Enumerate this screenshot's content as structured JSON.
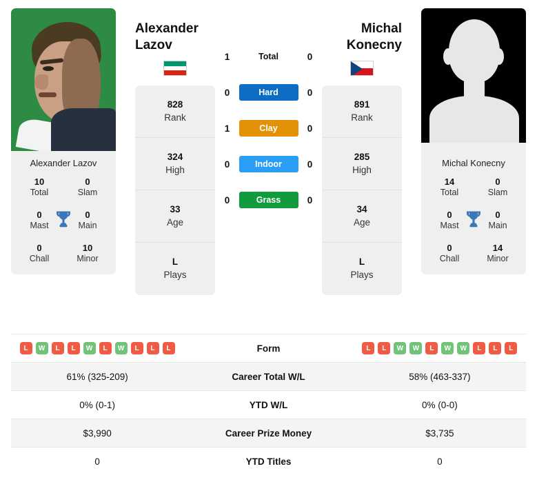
{
  "players": {
    "left": {
      "name": "Alexander Lazov",
      "name_line1": "Alexander",
      "name_line2": "Lazov",
      "flag": "bulgaria-flag",
      "photo": "player-photo",
      "stats": [
        {
          "value": "828",
          "key": "Rank"
        },
        {
          "value": "324",
          "key": "High"
        },
        {
          "value": "33",
          "key": "Age"
        },
        {
          "value": "L",
          "key": "Plays"
        }
      ],
      "titles": [
        {
          "value": "10",
          "key": "Total"
        },
        {
          "value": "0",
          "key": "Slam"
        },
        {
          "value": "0",
          "key": "Mast"
        },
        {
          "value": "0",
          "key": "Main"
        },
        {
          "value": "0",
          "key": "Chall"
        },
        {
          "value": "10",
          "key": "Minor"
        }
      ],
      "form": [
        "L",
        "W",
        "L",
        "L",
        "W",
        "L",
        "W",
        "L",
        "L",
        "L"
      ],
      "career_total_wl": "61% (325-209)",
      "ytd_wl": "0% (0-1)",
      "career_prize_money": "$3,990",
      "ytd_titles": "0"
    },
    "right": {
      "name": "Michal Konecny",
      "name_line1": "Michal",
      "name_line2": "Konecny",
      "flag": "czech-republic-flag",
      "photo": "player-photo-placeholder",
      "stats": [
        {
          "value": "891",
          "key": "Rank"
        },
        {
          "value": "285",
          "key": "High"
        },
        {
          "value": "34",
          "key": "Age"
        },
        {
          "value": "L",
          "key": "Plays"
        }
      ],
      "titles": [
        {
          "value": "14",
          "key": "Total"
        },
        {
          "value": "0",
          "key": "Slam"
        },
        {
          "value": "0",
          "key": "Mast"
        },
        {
          "value": "0",
          "key": "Main"
        },
        {
          "value": "0",
          "key": "Chall"
        },
        {
          "value": "14",
          "key": "Minor"
        }
      ],
      "form": [
        "L",
        "L",
        "W",
        "W",
        "L",
        "W",
        "W",
        "L",
        "L",
        "L"
      ],
      "career_total_wl": "58% (463-337)",
      "ytd_wl": "0% (0-0)",
      "career_prize_money": "$3,735",
      "ytd_titles": "0"
    }
  },
  "head_to_head": [
    {
      "label": "Total",
      "left": "1",
      "right": "0",
      "color": "",
      "plain": true
    },
    {
      "label": "Hard",
      "left": "0",
      "right": "0",
      "color": "#0b6ec4"
    },
    {
      "label": "Clay",
      "left": "1",
      "right": "0",
      "color": "#e39106"
    },
    {
      "label": "Indoor",
      "left": "0",
      "right": "0",
      "color": "#2a9df4"
    },
    {
      "label": "Grass",
      "left": "0",
      "right": "0",
      "color": "#119b3c"
    }
  ],
  "table_rows": [
    {
      "label": "Form",
      "type": "form"
    },
    {
      "label": "Career Total W/L",
      "type": "text",
      "left": "61% (325-209)",
      "right": "58% (463-337)"
    },
    {
      "label": "YTD W/L",
      "type": "text",
      "left": "0% (0-1)",
      "right": "0% (0-0)"
    },
    {
      "label": "Career Prize Money",
      "type": "text",
      "left": "$3,990",
      "right": "$3,735"
    },
    {
      "label": "YTD Titles",
      "type": "text",
      "left": "0",
      "right": "0"
    }
  ],
  "colors": {
    "win": "#72c278",
    "loss": "#ef5b45",
    "trophy": "#3b76b8",
    "card_bg": "#efefef"
  },
  "icons": {
    "trophy": "trophy-icon"
  }
}
